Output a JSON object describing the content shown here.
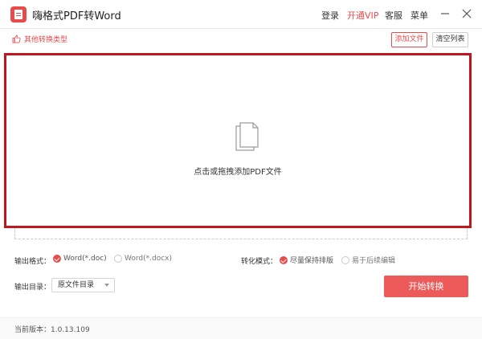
{
  "app": {
    "title": "嗨格式PDF转Word"
  },
  "nav": {
    "login": "登录",
    "vip": "开通VIP",
    "service": "客服",
    "menu": "菜单"
  },
  "toolbar": {
    "other_types": "其他转换类型",
    "add_file": "添加文件",
    "clear_list": "清空列表"
  },
  "drop": {
    "hint": "点击或拖拽添加PDF文件"
  },
  "output_format": {
    "label": "输出格式：",
    "options": [
      {
        "label": "Word(*.doc)",
        "checked": true
      },
      {
        "label": "Word(*.docx)",
        "checked": false
      }
    ]
  },
  "convert_mode": {
    "label": "转化模式：",
    "options": [
      {
        "label": "尽量保持排版",
        "checked": true
      },
      {
        "label": "易于后续编辑",
        "checked": false
      }
    ]
  },
  "output_dir": {
    "label": "输出目录：",
    "selected": "原文件目录"
  },
  "actions": {
    "start": "开始转换"
  },
  "status": {
    "version": "当前版本：1.0.13.109"
  },
  "colors": {
    "accent": "#e84b4b",
    "drop_border": "#c0161d",
    "start_button": "#ec5a5a"
  },
  "icons": [
    "pdf-app-icon",
    "thumb-icon",
    "document-stack-icon",
    "minimize-icon",
    "close-icon",
    "checkmark-icon",
    "caret-down-icon"
  ]
}
